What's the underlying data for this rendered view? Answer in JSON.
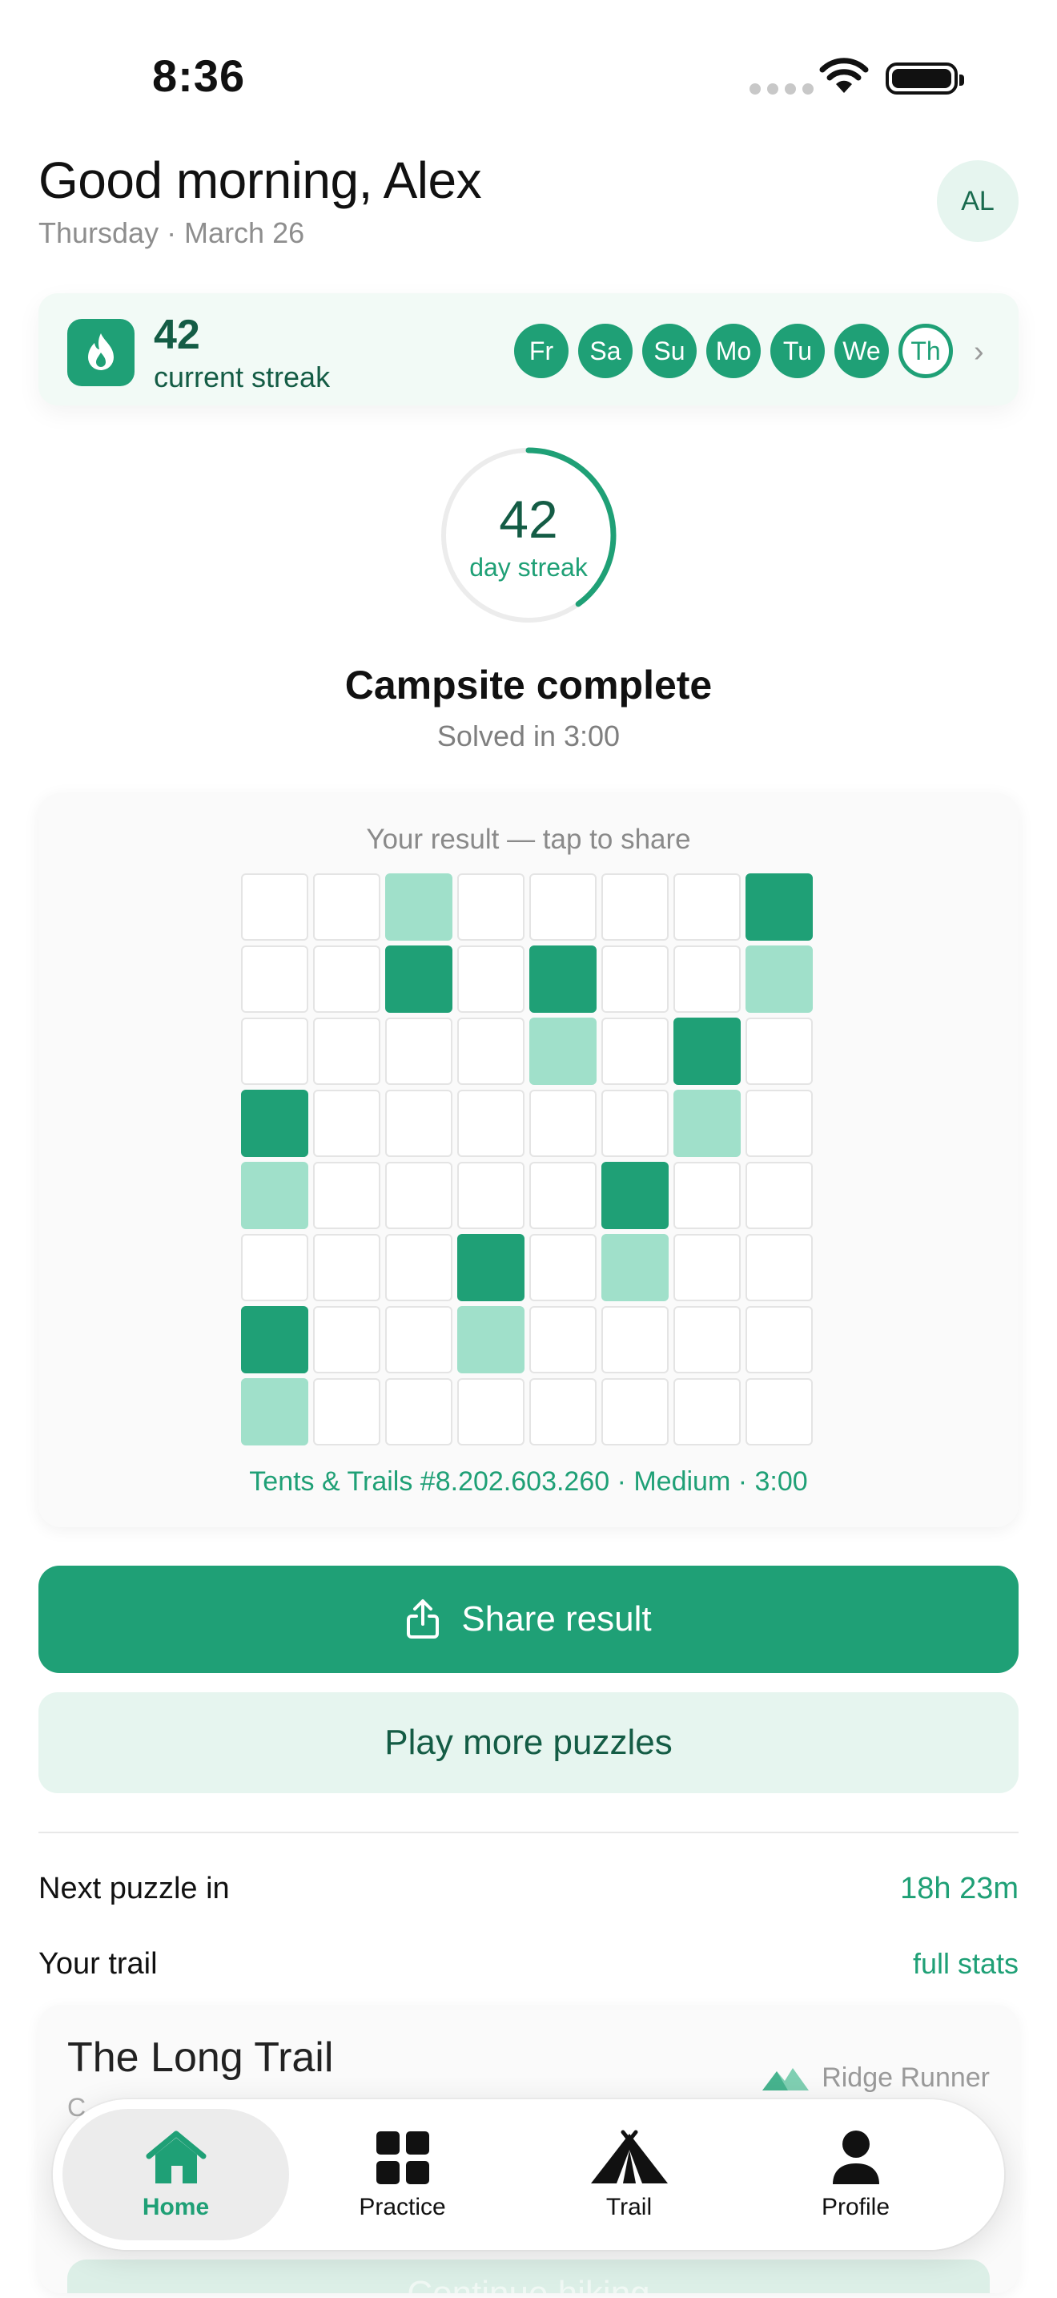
{
  "status": {
    "time": "8:36"
  },
  "header": {
    "greeting": "Good morning, Alex",
    "date": "Thursday · March 26",
    "avatar_initials": "AL"
  },
  "streak_card": {
    "count": "42",
    "label": "current streak",
    "days": [
      "Fr",
      "Sa",
      "Su",
      "Mo",
      "Tu",
      "We",
      "Th"
    ],
    "today": "Th"
  },
  "ring": {
    "value": "42",
    "label": "day streak",
    "progress": 0.4
  },
  "completion": {
    "title": "Campsite complete",
    "subtitle": "Solved in 3:00"
  },
  "result": {
    "caption": "Your result — tap to share",
    "footer": "Tents & Trails #8.202.603.260 · Medium · 3:00",
    "grid": [
      [
        "e",
        "e",
        "l",
        "e",
        "e",
        "e",
        "e",
        "d"
      ],
      [
        "e",
        "e",
        "d",
        "e",
        "d",
        "e",
        "e",
        "l"
      ],
      [
        "e",
        "e",
        "e",
        "e",
        "l",
        "e",
        "d",
        "e"
      ],
      [
        "d",
        "e",
        "e",
        "e",
        "e",
        "e",
        "l",
        "e"
      ],
      [
        "l",
        "e",
        "e",
        "e",
        "e",
        "d",
        "e",
        "e"
      ],
      [
        "e",
        "e",
        "e",
        "d",
        "e",
        "l",
        "e",
        "e"
      ],
      [
        "d",
        "e",
        "e",
        "l",
        "e",
        "e",
        "e",
        "e"
      ],
      [
        "l",
        "e",
        "e",
        "e",
        "e",
        "e",
        "e",
        "e"
      ]
    ]
  },
  "actions": {
    "share_label": "Share result",
    "more_label": "Play more puzzles"
  },
  "next": {
    "label": "Next puzzle in",
    "time": "18h 23m"
  },
  "trail": {
    "label": "Your trail",
    "link": "full stats",
    "title": "The Long Trail",
    "subtitle": "C",
    "rank": "Ridge Runner",
    "continue_label": "Continue hiking"
  },
  "tabs": [
    {
      "label": "Home",
      "icon": "home-icon",
      "active": true
    },
    {
      "label": "Practice",
      "icon": "grid-icon",
      "active": false
    },
    {
      "label": "Trail",
      "icon": "tent-icon",
      "active": false
    },
    {
      "label": "Profile",
      "icon": "person-icon",
      "active": false
    }
  ],
  "colors": {
    "accent": "#1fa076",
    "accent_dark": "#145c45",
    "accent_light": "#a0e0ca",
    "accent_bg": "#e6f5ef"
  }
}
